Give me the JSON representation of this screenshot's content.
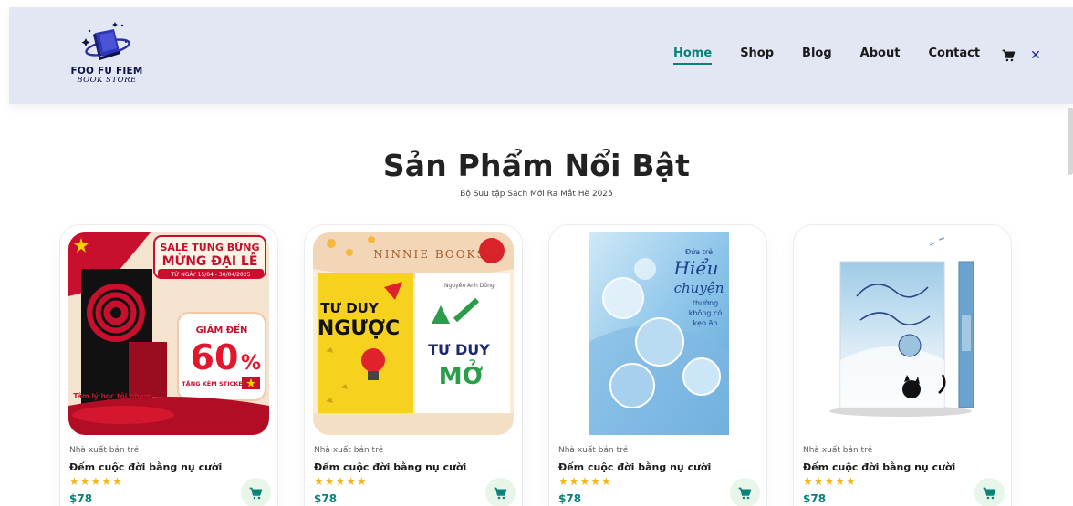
{
  "header": {
    "brand_name": "FOO FU FIEM",
    "brand_sub": "BOOK STORE",
    "nav": [
      {
        "label": "Home",
        "active": true
      },
      {
        "label": "Shop",
        "active": false
      },
      {
        "label": "Blog",
        "active": false
      },
      {
        "label": "About",
        "active": false
      },
      {
        "label": "Contact",
        "active": false
      }
    ],
    "cart_icon": "cart-icon",
    "close_label": "✕"
  },
  "section": {
    "title": "Sản Phẩm Nổi Bật",
    "subtitle": "Bộ Suu tập Sách Mới Ra Mắt Hè 2025"
  },
  "products": [
    {
      "brand": "Nhà xuất bản trẻ",
      "name": "Đếm cuộc đời bằng nụ cười",
      "stars": "★★★★★",
      "rating": 5,
      "price": "$78",
      "cover": {
        "banner_1": "SALE TUNG BỪNG",
        "banner_2": "MỪNG ĐẠI LỄ",
        "dates": "TỪ NGÀY 15/04 - 30/04/2025",
        "discount_label": "GIẢM ĐẾN",
        "discount_value": "60",
        "discount_unit": "%",
        "gift": "TẶNG KÈM STICKER",
        "book_title": "Tâm lý học tội phạm"
      }
    },
    {
      "brand": "Nhà xuất bản trẻ",
      "name": "Đếm cuộc đời bằng nụ cười",
      "stars": "★★★★★",
      "rating": 5,
      "price": "$78",
      "cover": {
        "publisher": "NINNIE BOOKS",
        "left_title_1": "TƯ DUY",
        "left_title_2": "NGƯỢC",
        "right_title_1": "TƯ DUY",
        "right_title_2": "MỞ"
      }
    },
    {
      "brand": "Nhà xuất bản trẻ",
      "name": "Đếm cuộc đời bằng nụ cười",
      "stars": "★★★★★",
      "rating": 5,
      "price": "$78",
      "cover": {
        "line_1": "Đứa trẻ",
        "line_2": "Hiểu",
        "line_3": "chuyện",
        "line_4": "thường",
        "line_5": "không có",
        "line_6": "kẹo ăn"
      }
    },
    {
      "brand": "Nhà xuất bản trẻ",
      "name": "Đếm cuộc đời bằng nụ cười",
      "stars": "★★★★★",
      "rating": 5,
      "price": "$78",
      "cover": {}
    }
  ],
  "colors": {
    "accent": "#088178",
    "header_bg": "#e3e6f3",
    "star": "#f3b519",
    "cart_bg": "#e8f6ea"
  }
}
